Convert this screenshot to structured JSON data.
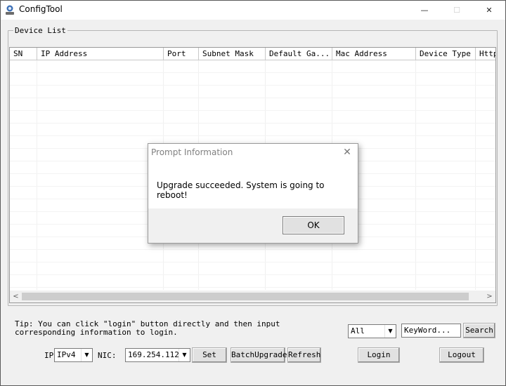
{
  "window": {
    "title": "ConfigTool"
  },
  "titlebar": {
    "minimize": "—",
    "maximize": "☐",
    "close": "✕"
  },
  "device_list": {
    "label": "Device List",
    "columns": [
      "SN",
      "IP Address",
      "Port",
      "Subnet Mask",
      "Default Ga...",
      "Mac Address",
      "Device Type",
      "Http"
    ],
    "rows": []
  },
  "scrollbar": {
    "left_arrow": "<",
    "right_arrow": ">"
  },
  "tip": {
    "text": "Tip: You can click \"login\" button directly and then input corresponding information to login."
  },
  "filter": {
    "selected": "All",
    "keyword_placeholder": "KeyWord...",
    "search_label": "Search"
  },
  "bottom": {
    "ip_label": "IP",
    "ip_version": "IPv4",
    "nic_label": "NIC:",
    "nic_value": "169.254.112.",
    "set_label": "Set",
    "batch_upgrade_label": "BatchUpgrade",
    "refresh_label": "Refresh",
    "login_label": "Login",
    "logout_label": "Logout"
  },
  "dialog": {
    "title": "Prompt Information",
    "message": "Upgrade succeeded. System is going to reboot!",
    "ok_label": "OK",
    "close_glyph": "✕"
  },
  "icons": {
    "app": "config-tool-icon",
    "combo_arrow": "chevron-down-icon"
  }
}
